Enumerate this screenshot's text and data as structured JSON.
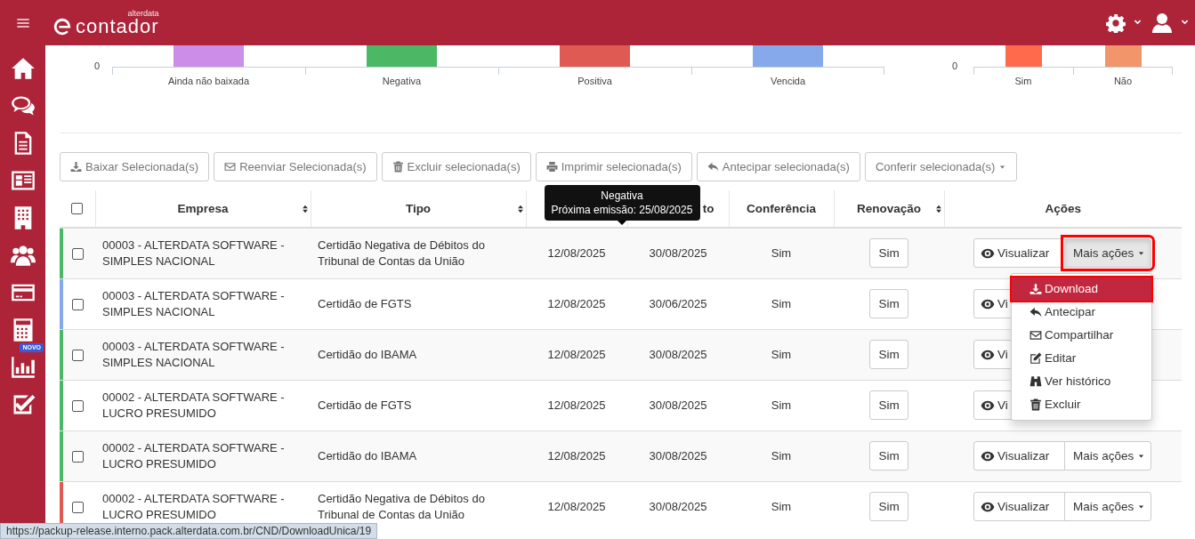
{
  "header": {
    "logo_brand": "alterdata",
    "logo_text": "contador"
  },
  "sidebar": {
    "badge": "NOVO"
  },
  "charts": [
    {
      "axis_tick": "0",
      "categories": [
        {
          "label": "Ainda não baixada",
          "color": "#cc8de8"
        },
        {
          "label": "Negativa",
          "color": "#4cb865"
        },
        {
          "label": "Positiva",
          "color": "#e05a54"
        },
        {
          "label": "Vencida",
          "color": "#85a9eb"
        }
      ]
    },
    {
      "axis_tick": "0",
      "categories": [
        {
          "label": "Sim",
          "color": "#ff6a4d"
        },
        {
          "label": "Não",
          "color": "#f2956a"
        }
      ]
    }
  ],
  "toolbar": [
    {
      "label": "Baixar Selecionada(s)",
      "dropdown": false
    },
    {
      "label": "Reenviar Selecionada(s)",
      "dropdown": false
    },
    {
      "label": "Excluir selecionada(s)",
      "dropdown": false
    },
    {
      "label": "Imprimir selecionada(s)",
      "dropdown": false
    },
    {
      "label": "Antecipar selecionada(s)",
      "dropdown": false
    },
    {
      "label": "Conferir selecionada(s)",
      "dropdown": true
    }
  ],
  "table": {
    "columns": [
      {
        "kind": "checkbox",
        "checked": false
      },
      {
        "kind": "text",
        "label": "Empresa",
        "sortable": true
      },
      {
        "kind": "text",
        "label": "Tipo",
        "sortable": true
      },
      {
        "kind": "text"
      },
      {
        "kind": "text",
        "label": "to",
        "sortable": false
      },
      {
        "kind": "text",
        "label": "Conferência",
        "sortable": false
      },
      {
        "kind": "text",
        "label": "Renovação",
        "sortable": true
      },
      {
        "kind": "text",
        "label": "Ações",
        "sortable": false
      }
    ],
    "rows": [
      {
        "color": "#4cb865",
        "checked": false,
        "empresa": "00003 - ALTERDATA SOFTWARE - SIMPLES NACIONAL",
        "tipo": "Certidão Negativa de Débitos do Tribunal de Contas da União",
        "cadastro": "12/08/2025",
        "vencimento": "30/08/2025",
        "conferencia": "Sim",
        "renovacao": "Sim",
        "view": "Visualizar",
        "more": {
          "label": "Mais ações",
          "pressed": true,
          "outlined": true
        }
      },
      {
        "color": "#85a9eb",
        "checked": false,
        "empresa": "00003 - ALTERDATA SOFTWARE - SIMPLES NACIONAL",
        "tipo": "Certidão de FGTS",
        "cadastro": "12/08/2025",
        "vencimento": "30/06/2025",
        "conferencia": "Sim",
        "renovacao": "Sim",
        "view": "Vi"
      },
      {
        "color": "#4cb865",
        "checked": false,
        "empresa": "00003 - ALTERDATA SOFTWARE - SIMPLES NACIONAL",
        "tipo": "Certidão do IBAMA",
        "cadastro": "12/08/2025",
        "vencimento": "30/08/2025",
        "conferencia": "Sim",
        "renovacao": "Sim",
        "view": "Vi"
      },
      {
        "color": "#4cb865",
        "checked": false,
        "empresa": "00002 - ALTERDATA SOFTWARE - LUCRO PRESUMIDO",
        "tipo": "Certidão de FGTS",
        "cadastro": "12/08/2025",
        "vencimento": "30/08/2025",
        "conferencia": "Sim",
        "renovacao": "Sim",
        "view": "Vi"
      },
      {
        "color": "#4cb865",
        "checked": false,
        "empresa": "00002 - ALTERDATA SOFTWARE - LUCRO PRESUMIDO",
        "tipo": "Certidão do IBAMA",
        "cadastro": "12/08/2025",
        "vencimento": "30/08/2025",
        "conferencia": "Sim",
        "renovacao": "Sim",
        "view": "Visualizar",
        "more": {
          "label": "Mais ações",
          "pressed": false,
          "outlined": false
        }
      },
      {
        "color": "#e05a54",
        "checked": false,
        "empresa": "00002 - ALTERDATA SOFTWARE - LUCRO PRESUMIDO",
        "tipo": "Certidão Negativa de Débitos do Tribunal de Contas da União",
        "cadastro": "12/08/2025",
        "vencimento": "30/08/2025",
        "conferencia": "Sim",
        "renovacao": "Sim",
        "view": "Visualizar",
        "more": {
          "label": "Mais ações",
          "pressed": false,
          "outlined": false
        }
      }
    ]
  },
  "menu": {
    "items": [
      {
        "label": "Download",
        "active": true,
        "outlined": true
      },
      {
        "label": "Antecipar",
        "active": false,
        "outlined": false
      },
      {
        "label": "Compartilhar",
        "active": false,
        "outlined": false
      },
      {
        "label": "Editar",
        "active": false,
        "outlined": false
      },
      {
        "label": "Ver histórico",
        "active": false,
        "outlined": false
      },
      {
        "label": "Excluir",
        "active": false,
        "outlined": false
      }
    ]
  },
  "tooltip": {
    "title": "Negativa",
    "text": "Próxima emissão: 25/08/2025"
  },
  "status_url": "https://packup-release.interno.pack.alterdata.com.br/CND/DownloadUnica/19"
}
